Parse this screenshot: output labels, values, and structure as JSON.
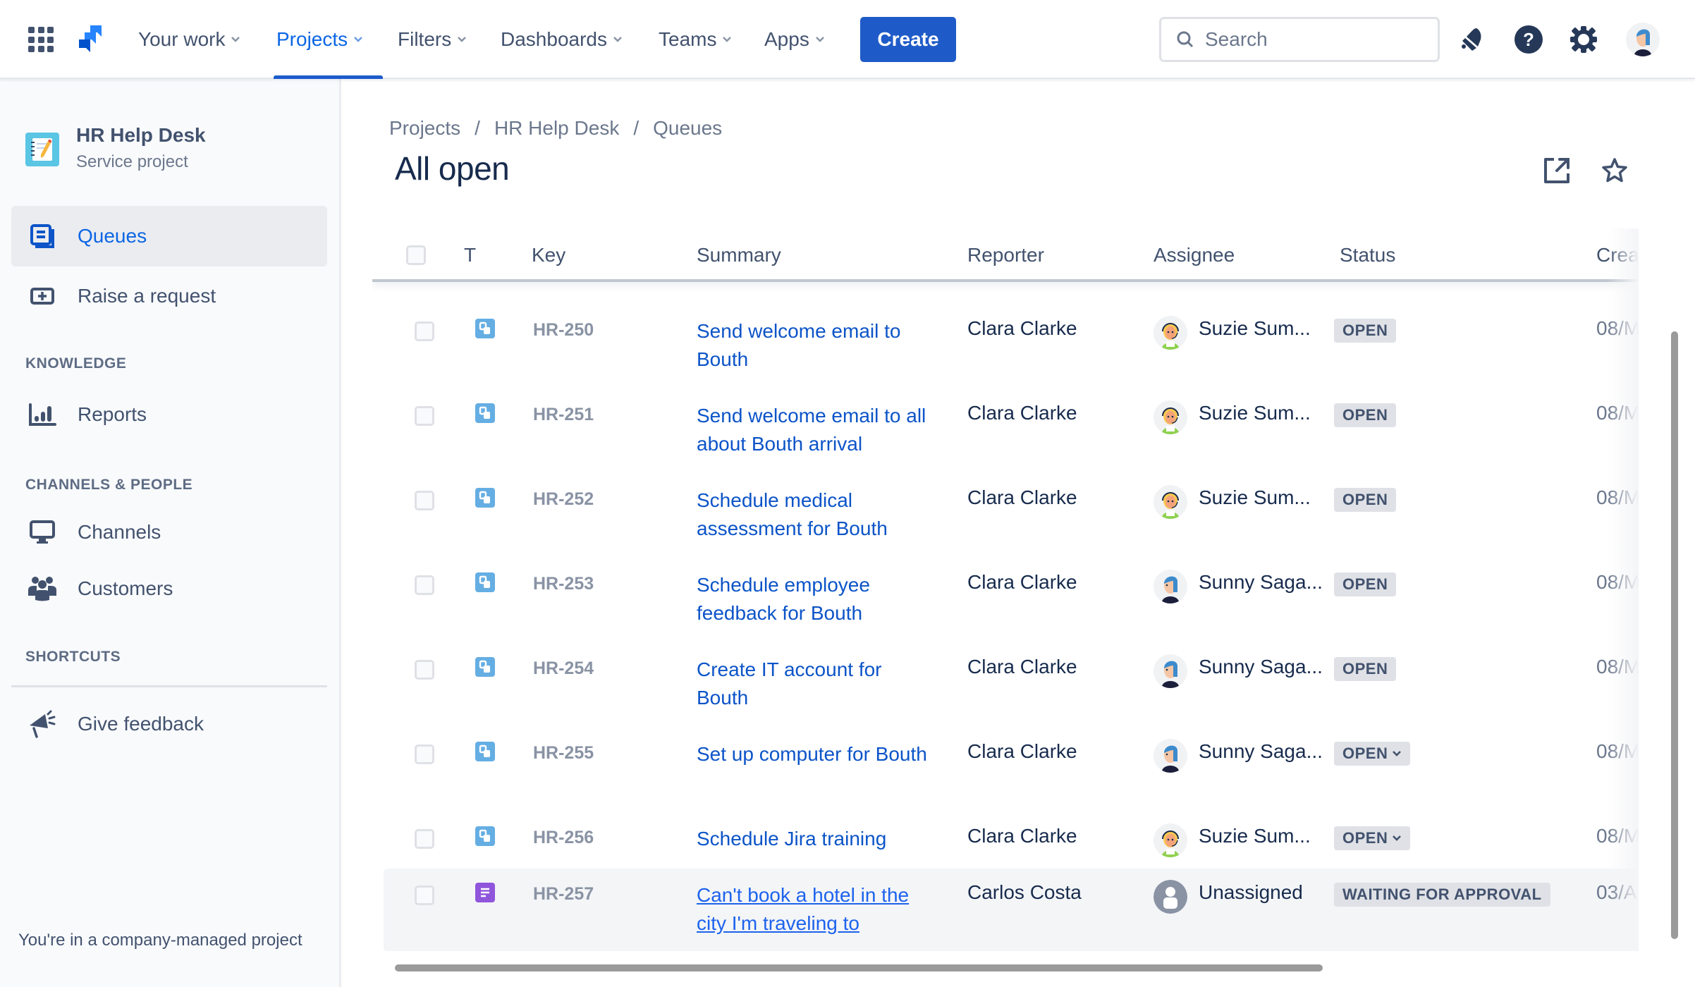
{
  "topnav": {
    "items": [
      {
        "label": "Your work",
        "active": false
      },
      {
        "label": "Projects",
        "active": true
      },
      {
        "label": "Filters",
        "active": false
      },
      {
        "label": "Dashboards",
        "active": false
      },
      {
        "label": "Teams",
        "active": false
      },
      {
        "label": "Apps",
        "active": false
      }
    ],
    "create_label": "Create",
    "search_placeholder": "Search",
    "icons": [
      "notifications-icon",
      "help-icon",
      "settings-icon",
      "profile-avatar"
    ]
  },
  "sidebar": {
    "project_name": "HR Help Desk",
    "project_type": "Service project",
    "items": [
      {
        "label": "Queues",
        "icon": "queues-icon",
        "active": true
      },
      {
        "label": "Raise a request",
        "icon": "raise-request-icon",
        "active": false
      }
    ],
    "sections": [
      {
        "title": "KNOWLEDGE",
        "items": [
          {
            "label": "Reports",
            "icon": "reports-icon"
          }
        ]
      },
      {
        "title": "CHANNELS & PEOPLE",
        "items": [
          {
            "label": "Channels",
            "icon": "monitor-icon"
          },
          {
            "label": "Customers",
            "icon": "customers-icon"
          }
        ]
      },
      {
        "title": "SHORTCUTS",
        "items": []
      }
    ],
    "feedback_label": "Give feedback",
    "footer": "You're in a company-managed project"
  },
  "main": {
    "breadcrumb": [
      "Projects",
      "HR Help Desk",
      "Queues"
    ],
    "title": "All open",
    "columns": [
      "T",
      "Key",
      "Summary",
      "Reporter",
      "Assignee",
      "Status",
      "Crea"
    ],
    "rows": [
      {
        "type": "service-request",
        "key": "HR-250",
        "summary": "Send welcome email to Bouth",
        "reporter": "Clara Clarke",
        "assignee": "Suzie Sum...",
        "avatar": "suzie",
        "status": "OPEN",
        "status_dropdown": false,
        "created": "08/M"
      },
      {
        "type": "service-request",
        "key": "HR-251",
        "summary": "Send welcome email to all about Bouth arrival",
        "reporter": "Clara Clarke",
        "assignee": "Suzie Sum...",
        "avatar": "suzie",
        "status": "OPEN",
        "status_dropdown": false,
        "created": "08/M"
      },
      {
        "type": "service-request",
        "key": "HR-252",
        "summary": "Schedule medical assessment for Bouth",
        "reporter": "Clara Clarke",
        "assignee": "Suzie Sum...",
        "avatar": "suzie",
        "status": "OPEN",
        "status_dropdown": false,
        "created": "08/M"
      },
      {
        "type": "service-request",
        "key": "HR-253",
        "summary": "Schedule employee feedback for Bouth",
        "reporter": "Clara Clarke",
        "assignee": "Sunny Saga...",
        "avatar": "sunny",
        "status": "OPEN",
        "status_dropdown": false,
        "created": "08/M"
      },
      {
        "type": "service-request",
        "key": "HR-254",
        "summary": "Create IT account for Bouth",
        "reporter": "Clara Clarke",
        "assignee": "Sunny Saga...",
        "avatar": "sunny",
        "status": "OPEN",
        "status_dropdown": false,
        "created": "08/M"
      },
      {
        "type": "service-request",
        "key": "HR-255",
        "summary": "Set up computer for Bouth",
        "reporter": "Clara Clarke",
        "assignee": "Sunny Saga...",
        "avatar": "sunny",
        "status": "OPEN",
        "status_dropdown": true,
        "created": "08/M"
      },
      {
        "type": "service-request",
        "key": "HR-256",
        "summary": "Schedule Jira training",
        "reporter": "Clara Clarke",
        "assignee": "Suzie Sum...",
        "avatar": "suzie",
        "status": "OPEN",
        "status_dropdown": true,
        "created": "08/M"
      },
      {
        "type": "ask-question",
        "key": "HR-257",
        "summary": "Can't book a hotel in the city I'm traveling to",
        "reporter": "Carlos Costa",
        "assignee": "Unassigned",
        "avatar": "unassigned",
        "status": "WAITING FOR APPROVAL",
        "status_dropdown": false,
        "created": "03/A",
        "highlighted": true
      }
    ]
  },
  "colors": {
    "accent": "#0c66e4",
    "create_button": "#1f5bc8",
    "link": "#0c54c8",
    "status_bg": "#dfe1e6",
    "service_request_icon": "#65aee3",
    "ask_question_icon": "#8f56dc"
  }
}
